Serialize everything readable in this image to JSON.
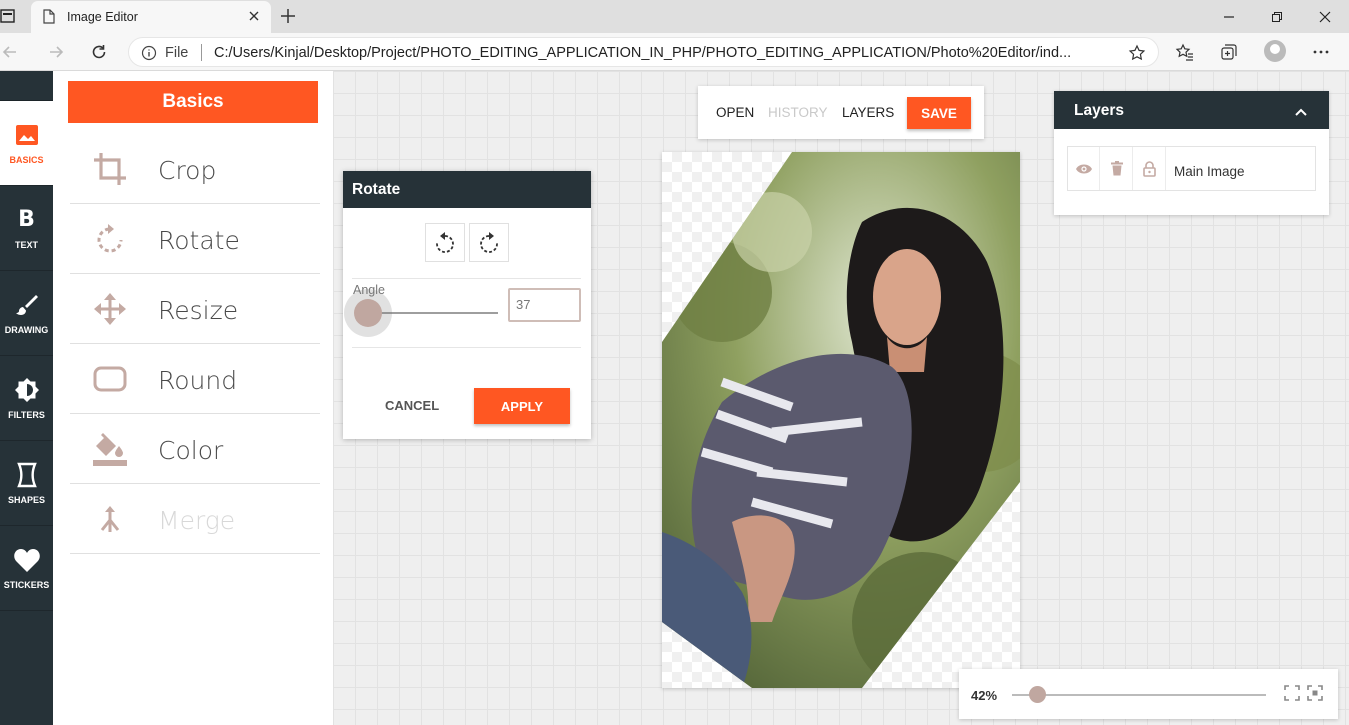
{
  "browser": {
    "tab_title": "Image Editor",
    "address_prefix": "File",
    "url": "C:/Users/Kinjal/Desktop/Project/PHOTO_EDITING_APPLICATION_IN_PHP/PHOTO_EDITING_APPLICATION/Photo%20Editor/ind..."
  },
  "rail": {
    "items": [
      {
        "label": "BASICS",
        "icon": "image-icon",
        "active": true
      },
      {
        "label": "TEXT",
        "icon": "bold-text-icon"
      },
      {
        "label": "DRAWING",
        "icon": "brush-icon"
      },
      {
        "label": "FILTERS",
        "icon": "brightness-icon"
      },
      {
        "label": "SHAPES",
        "icon": "shape-icon"
      },
      {
        "label": "STICKERS",
        "icon": "heart-icon"
      }
    ]
  },
  "basics": {
    "title": "Basics",
    "tools": [
      {
        "label": "Crop",
        "icon": "crop-icon"
      },
      {
        "label": "Rotate",
        "icon": "rotate-icon"
      },
      {
        "label": "Resize",
        "icon": "move-arrows-icon"
      },
      {
        "label": "Round",
        "icon": "rounded-rect-icon"
      },
      {
        "label": "Color",
        "icon": "paint-bucket-icon"
      },
      {
        "label": "Merge",
        "icon": "merge-icon",
        "disabled": true
      }
    ]
  },
  "toolbar": {
    "open": "OPEN",
    "history": "HISTORY",
    "layers": "LAYERS",
    "save": "SAVE"
  },
  "rotate_panel": {
    "title": "Rotate",
    "angle_label": "Angle",
    "angle_value": "37",
    "cancel": "CANCEL",
    "apply": "APPLY"
  },
  "layers_panel": {
    "title": "Layers",
    "layer_name": "Main Image"
  },
  "zoom": {
    "value": "42%",
    "level": 0.1
  },
  "colors": {
    "accent": "#ff5722",
    "dark": "#263238"
  }
}
